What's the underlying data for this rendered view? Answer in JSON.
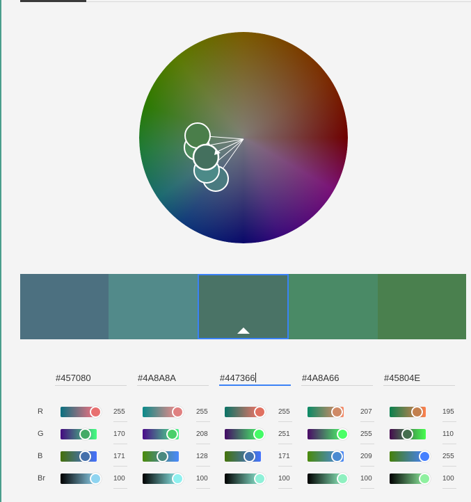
{
  "tabs": {
    "active_index": 0
  },
  "swatch_colors": [
    "#4c7080",
    "#528a8a",
    "#4a7366",
    "#4a8a66",
    "#4a804e"
  ],
  "selected_swatch": 2,
  "hex_values": [
    "#457080",
    "#4A8A8A",
    "#447366",
    "#4A8A66",
    "#45804E"
  ],
  "row_labels": [
    "R",
    "G",
    "B",
    "Br"
  ],
  "rows": [
    {
      "values": [
        "255",
        "255",
        "255",
        "207",
        "195"
      ],
      "knob_fraction": [
        1.0,
        1.0,
        1.0,
        0.81,
        0.76
      ],
      "knob_colors": [
        "#e87070",
        "#e08080",
        "#e07060",
        "#cf8a66",
        "#c3804e"
      ]
    },
    {
      "values": [
        "170",
        "208",
        "251",
        "255",
        "110"
      ],
      "knob_fraction": [
        0.67,
        0.82,
        0.98,
        1.0,
        0.43
      ],
      "knob_colors": [
        "#44aa66",
        "#4acf6a",
        "#44fb66",
        "#4aff66",
        "#456e4e"
      ]
    },
    {
      "values": [
        "171",
        "128",
        "171",
        "209",
        "255"
      ],
      "knob_fraction": [
        0.67,
        0.5,
        0.67,
        0.82,
        1.0
      ],
      "knob_colors": [
        "#4570ab",
        "#4a8a80",
        "#4473ab",
        "#4a8ad1",
        "#4580ff"
      ]
    },
    {
      "values": [
        "100",
        "100",
        "100",
        "100",
        "100"
      ],
      "knob_fraction": [
        1.0,
        1.0,
        1.0,
        1.0,
        1.0
      ],
      "knob_colors": [
        "#8fd4f0",
        "#8ff0ef",
        "#8ff0d8",
        "#8ff0c0",
        "#8ff0a0"
      ]
    }
  ]
}
